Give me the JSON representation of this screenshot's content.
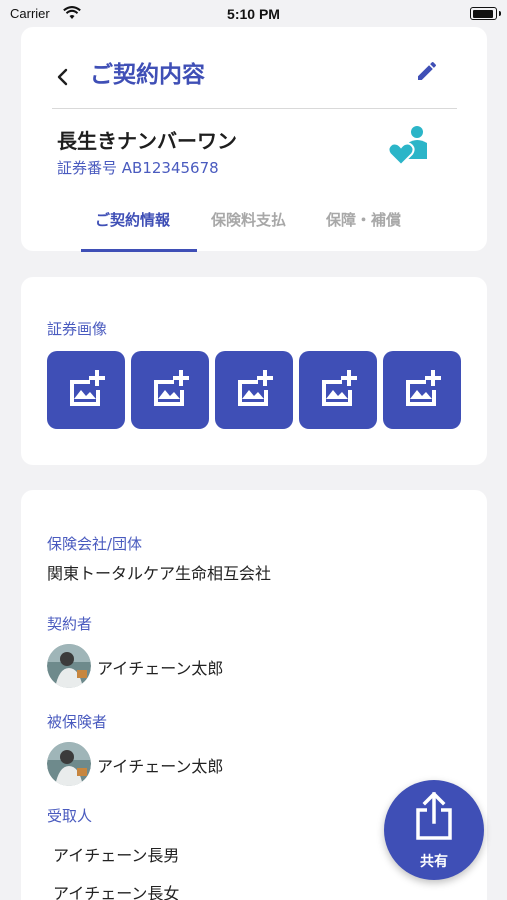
{
  "status_bar": {
    "carrier": "Carrier",
    "time": "5:10 PM"
  },
  "header": {
    "title": "ご契約内容",
    "product_name": "長生きナンバーワン",
    "policy_number": "証券番号 AB12345678",
    "tabs": [
      {
        "label": "ご契約情報",
        "active": true
      },
      {
        "label": "保険料支払",
        "active": false
      },
      {
        "label": "保障・補償",
        "active": false
      }
    ]
  },
  "images_section": {
    "label": "証券画像",
    "buttons": [
      "add-image-icon",
      "add-image-icon",
      "add-image-icon",
      "add-image-icon",
      "add-image-icon"
    ]
  },
  "details": {
    "insurer_label": "保険会社/団体",
    "insurer_value": "関東トータルケア生命相互会社",
    "policyholder_label": "契約者",
    "policyholder_name": "アイチェーン太郎",
    "insured_label": "被保険者",
    "insured_name": "アイチェーン太郎",
    "beneficiary_label": "受取人",
    "beneficiaries": [
      "アイチェーン長男",
      "アイチェーン長女"
    ]
  },
  "fab": {
    "label": "共有",
    "icon": "share-icon"
  },
  "colors": {
    "accent": "#3f4fb6",
    "teal": "#2bb5c8",
    "background": "#f2f2f4"
  }
}
